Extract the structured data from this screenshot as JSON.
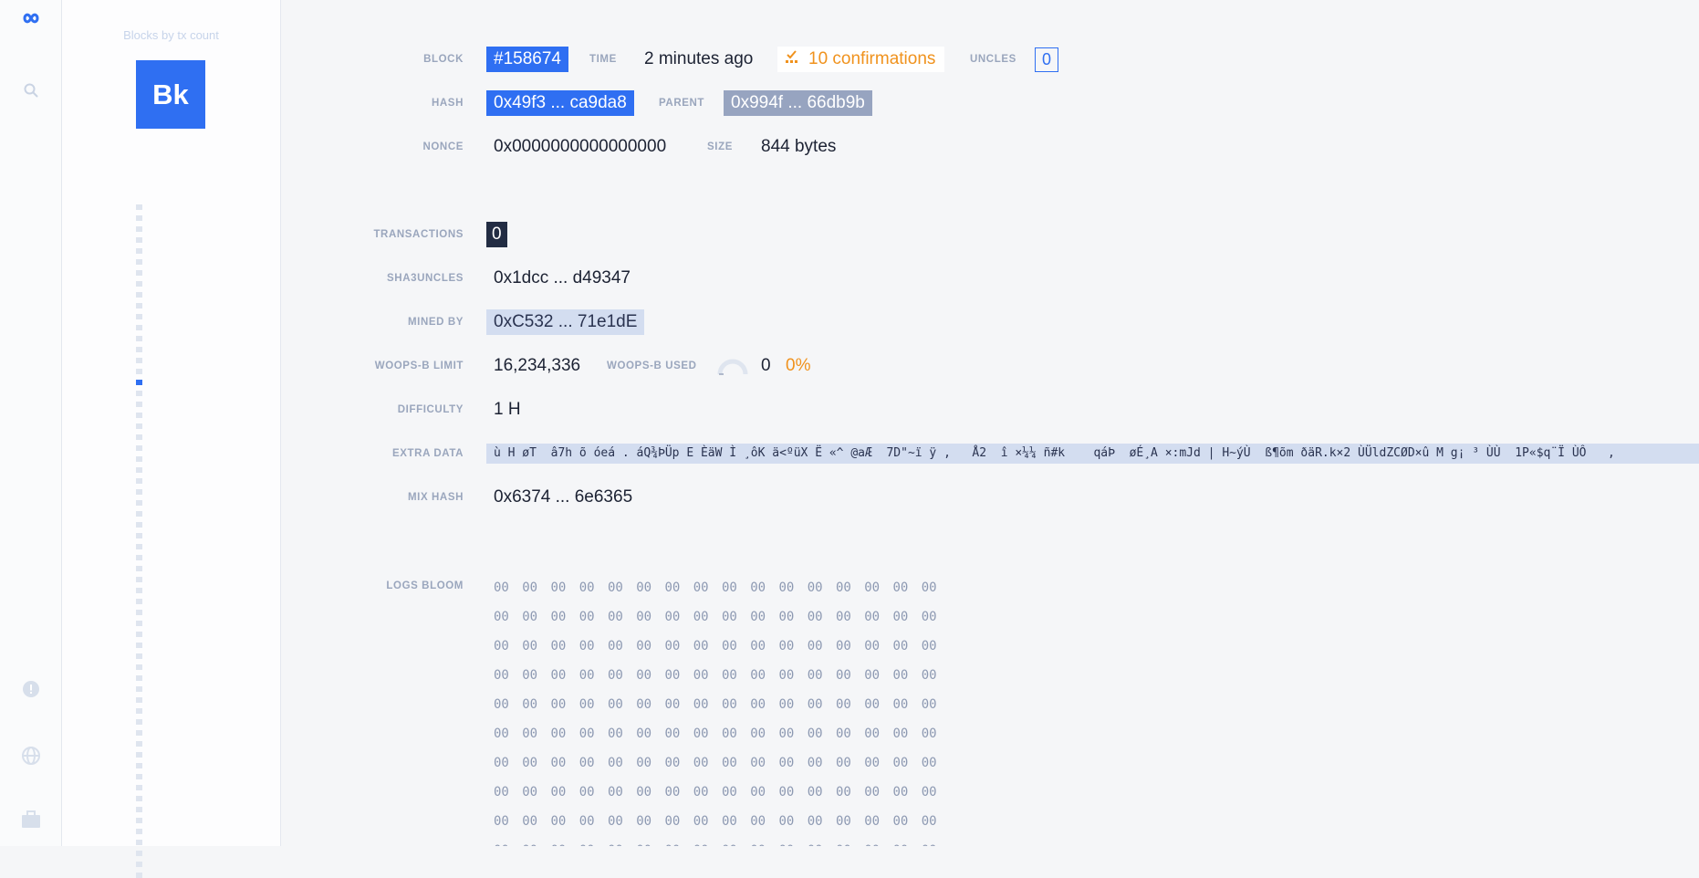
{
  "rail": {
    "logo_icon": "infinity-logo-icon",
    "search_icon": "search-icon",
    "bottom_icons": [
      "alert-circle-icon",
      "globe-icon",
      "briefcase-icon"
    ]
  },
  "strip": {
    "title": "Blocks by tx count",
    "logo_text": "Bk",
    "dot_count": 62,
    "active_dot_index": 16
  },
  "block": {
    "block_label": "BLOCK",
    "number": "#158674",
    "time_label": "TIME",
    "time": "2 minutes ago",
    "confirmations": "10 confirmations",
    "uncles_label": "UNCLES",
    "uncles": "0",
    "hash_label": "HASH",
    "hash": "0x49f3 ... ca9da8",
    "parent_label": "PARENT",
    "parent": "0x994f ... 66db9b",
    "nonce_label": "NONCE",
    "nonce": "0x0000000000000000",
    "size_label": "SIZE",
    "size": "844 bytes",
    "transactions_label": "TRANSACTIONS",
    "transactions": "0",
    "sha3uncles_label": "SHA3UNCLES",
    "sha3uncles": "0x1dcc ... d49347",
    "mined_by_label": "MINED BY",
    "mined_by": "0xC532 ... 71e1dE",
    "gas_limit_label": "WOOPS-B LIMIT",
    "gas_limit": "16,234,336",
    "gas_used_label": "WOOPS-B USED",
    "gas_used": "0",
    "gas_used_pct": "0%",
    "gas_used_fraction": 0,
    "difficulty_label": "DIFFICULTY",
    "difficulty": "1 H",
    "extra_data_label": "EXTRA DATA",
    "extra_data": "ù H øT  â7h õ óeá . áQ¾ÞÜp E ÈäW Ì ¸ôK ä<ºüX Ë «^ @aÆ  7D\"~ï ÿ ,   Å2  î ×¼¼ ñ#k    qáÞ  øÉ¸A ×:mJd | H~ýÙ  ß¶õm ðäR.k×2 ÙÜldZCØD×û M g¡ ³ ÙÙ  1P«$q¨Ï ÙÔ   ,",
    "mix_hash_label": "MIX HASH",
    "mix_hash": "0x6374 ... 6e6365",
    "logs_bloom_label": "LOGS BLOOM",
    "logs_bloom_cell": "00",
    "logs_bloom_rows_visible": 10,
    "logs_bloom_cols": 16
  },
  "colors": {
    "accent": "#2f6ff2",
    "parent_pill": "#97a4c0",
    "highlight_pill": "#d3ddf0",
    "dark_pill": "#222c43",
    "confirmations": "#f0921d"
  }
}
